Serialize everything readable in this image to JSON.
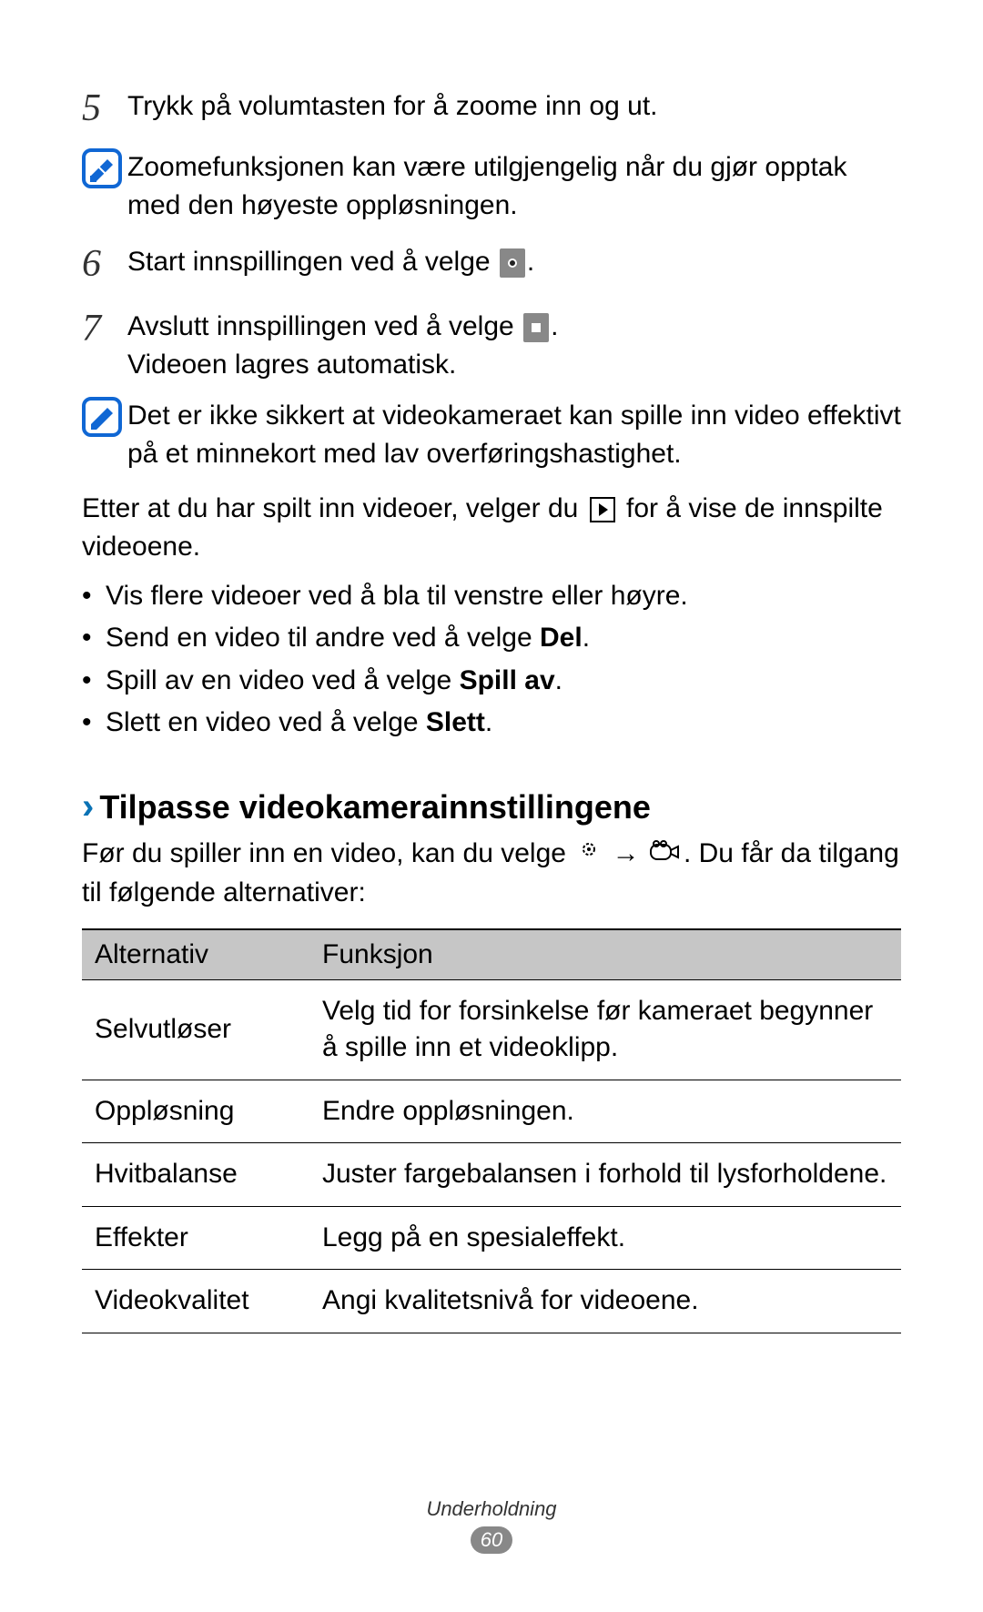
{
  "steps": {
    "s5": {
      "num": "5",
      "text": "Trykk på volumtasten for å zoome inn og ut."
    },
    "s6": {
      "num": "6",
      "text_before": "Start innspillingen ved å velge ",
      "text_after": "."
    },
    "s7": {
      "num": "7",
      "line1_before": "Avslutt innspillingen ved å velge ",
      "line1_after": ".",
      "line2": "Videoen lagres automatisk."
    }
  },
  "notes": {
    "n1": "Zoomefunksjonen kan være utilgjengelig når du gjør opptak med den høyeste oppløsningen.",
    "n2": "Det er ikke sikkert at videokameraet kan spille inn video effektivt på et minnekort med lav overføringshastighet."
  },
  "para1": {
    "before": "Etter at du har spilt inn videoer, velger du ",
    "after": " for å vise de innspilte videoene."
  },
  "bullets": {
    "b1": "Vis flere videoer ved å bla til venstre eller høyre.",
    "b2_before": "Send en video til andre ved å velge ",
    "b2_bold": "Del",
    "b2_after": ".",
    "b3_before": "Spill av en video ved å velge ",
    "b3_bold": "Spill av",
    "b3_after": ".",
    "b4_before": "Slett en video ved å velge ",
    "b4_bold": "Slett",
    "b4_after": "."
  },
  "section": {
    "chevron": "›",
    "title": "Tilpasse videokamerainnstillingene",
    "para_before": "Før du spiller inn en video, kan du velge ",
    "para_arrow": " → ",
    "para_after": ". Du får da tilgang til følgende alternativer:"
  },
  "table": {
    "head": {
      "c1": "Alternativ",
      "c2": "Funksjon"
    },
    "rows": [
      {
        "c1": "Selvutløser",
        "c2": "Velg tid for forsinkelse før kameraet begynner å spille inn et videoklipp."
      },
      {
        "c1": "Oppløsning",
        "c2": "Endre oppløsningen."
      },
      {
        "c1": "Hvitbalanse",
        "c2": "Juster fargebalansen i forhold til lysforholdene."
      },
      {
        "c1": "Effekter",
        "c2": "Legg på en spesialeffekt."
      },
      {
        "c1": "Videokvalitet",
        "c2": "Angi kvalitetsnivå for videoene."
      }
    ]
  },
  "footer": {
    "section": "Underholdning",
    "page": "60"
  }
}
